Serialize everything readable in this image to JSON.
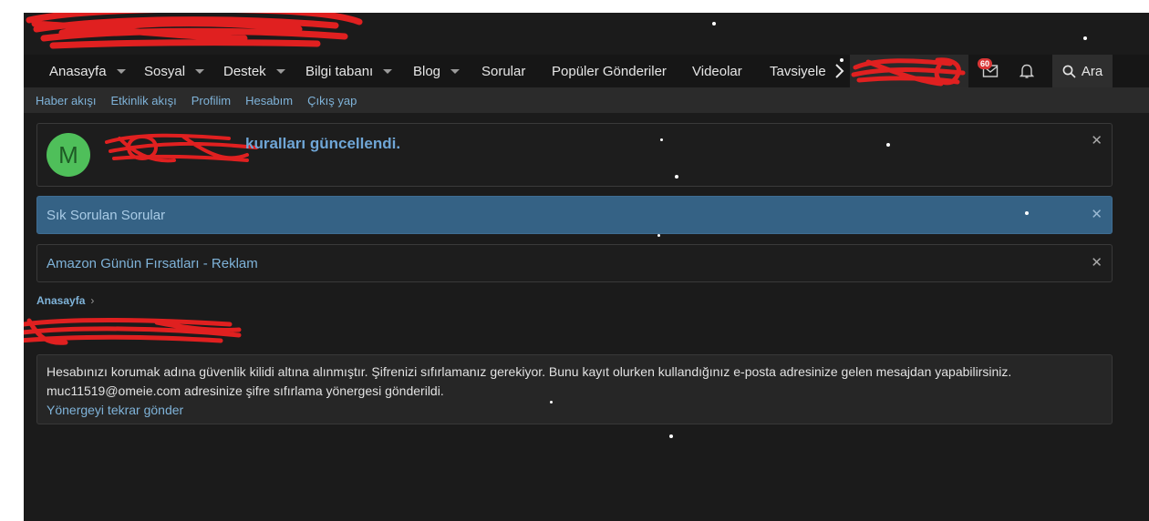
{
  "nav": {
    "items": [
      {
        "label": "Anasayfa",
        "dropdown": true
      },
      {
        "label": "Sosyal",
        "dropdown": true
      },
      {
        "label": "Destek",
        "dropdown": true
      },
      {
        "label": "Bilgi tabanı",
        "dropdown": true
      },
      {
        "label": "Blog",
        "dropdown": true
      },
      {
        "label": "Sorular",
        "dropdown": false
      },
      {
        "label": "Popüler Gönderiler",
        "dropdown": false
      },
      {
        "label": "Videolar",
        "dropdown": false
      },
      {
        "label": "Tavsiyele",
        "dropdown": false
      }
    ],
    "inbox_badge": "60",
    "search_label": "Ara",
    "icons": [
      "chevron-right-icon",
      "inbox-icon",
      "bell-icon",
      "search-icon"
    ]
  },
  "subnav": {
    "links": [
      "Haber akışı",
      "Etkinlik akışı",
      "Profilim",
      "Hesabım",
      "Çıkış yap"
    ]
  },
  "notices": {
    "rules": {
      "avatar_letter": "M",
      "title": "kuralları güncellendi."
    },
    "faq": {
      "text": "Sık Sorulan Sorular"
    },
    "ad": {
      "text": "Amazon Günün Fırsatları - Reklam"
    }
  },
  "breadcrumb": {
    "home": "Anasayfa",
    "separator": "›"
  },
  "message": {
    "line1": "Hesabınızı korumak adına güvenlik kilidi altına alınmıştır. Şifrenizi sıfırlamanız gerekiyor. Bunu kayıt olurken kullandığınız e-posta adresinize gelen mesajdan yapabilirsiniz.",
    "line2": "muc11519@omeie.com adresinize şifre sıfırlama yönergesi gönderildi.",
    "resend_link": "Yönergeyi tekrar gönder"
  },
  "colors": {
    "page_bg": "#1b1b1b",
    "nav_bg": "#161616",
    "subnav_bg": "#2b2b2b",
    "link": "#7fb3d9",
    "faq_bg": "#356285",
    "avatar_bg": "#4fbf5a",
    "badge": "#d93636",
    "redaction": "#e02020"
  }
}
